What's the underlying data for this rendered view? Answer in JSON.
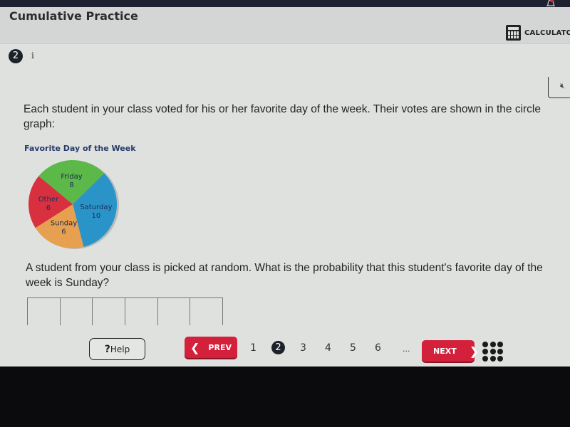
{
  "header": {
    "title": "Cumulative Practice",
    "calculator_label": "CALCULATOR"
  },
  "question": {
    "number": "2",
    "info_label": "i",
    "prompt": "Each student in your class voted for his or her favorite day of the week. Their votes are shown in the circle graph:",
    "text": "A student from your class is picked at random. What is the probability that this student's favorite day of the week is Sunday?",
    "answer_cells": 6
  },
  "chart_data": {
    "type": "pie",
    "title": "Favorite Day of the Week",
    "slices": [
      {
        "label": "Friday",
        "value": 8,
        "color": "#5cb849"
      },
      {
        "label": "Saturday",
        "value": 10,
        "color": "#2a94c9"
      },
      {
        "label": "Sunday",
        "value": 6,
        "color": "#e6a050"
      },
      {
        "label": "Other",
        "value": 6,
        "color": "#d93040"
      }
    ]
  },
  "nav": {
    "help_icon": "?",
    "help_label": "Help",
    "prev_label": "PREV",
    "next_label": "NEXT",
    "pages": [
      "1",
      "2",
      "3",
      "4",
      "5",
      "6"
    ],
    "current_page": "2",
    "ellipsis": "..."
  }
}
